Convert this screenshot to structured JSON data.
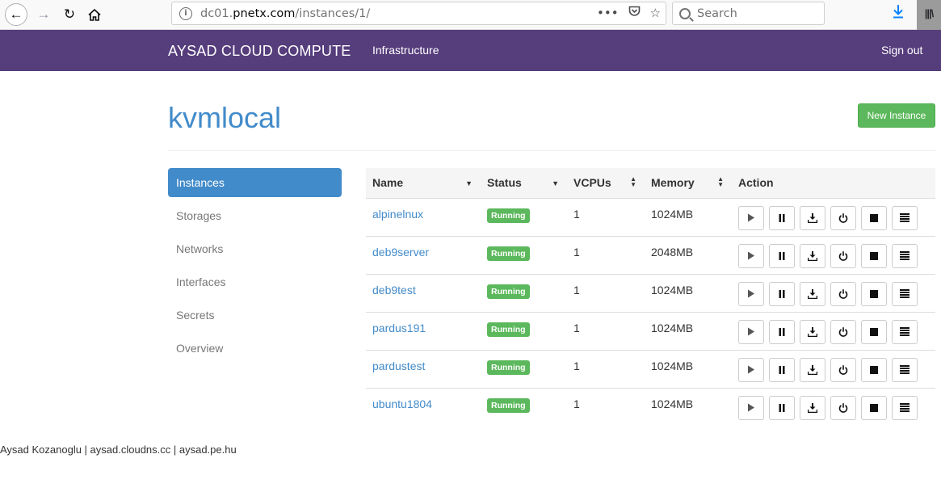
{
  "browser": {
    "url_prefix": "dc01.",
    "url_host": "pnetx.com",
    "url_path": "/instances/1/",
    "search_placeholder": "Search"
  },
  "navbar": {
    "brand": "AYSAD CLOUD COMPUTE",
    "infrastructure": "Infrastructure",
    "signout": "Sign out",
    "bg_color": "#563d7c"
  },
  "page": {
    "title": "kvmlocal",
    "new_instance_label": "New Instance"
  },
  "sidebar": {
    "items": [
      {
        "label": "Instances",
        "active": true
      },
      {
        "label": "Storages"
      },
      {
        "label": "Networks"
      },
      {
        "label": "Interfaces"
      },
      {
        "label": "Secrets"
      },
      {
        "label": "Overview"
      }
    ]
  },
  "table": {
    "headers": {
      "name": "Name",
      "status": "Status",
      "vcpus": "VCPUs",
      "memory": "Memory",
      "action": "Action"
    },
    "rows": [
      {
        "name": "alpinelnux",
        "status": "Running",
        "vcpus": "1",
        "memory": "1024MB"
      },
      {
        "name": "deb9server",
        "status": "Running",
        "vcpus": "1",
        "memory": "2048MB"
      },
      {
        "name": "deb9test",
        "status": "Running",
        "vcpus": "1",
        "memory": "1024MB"
      },
      {
        "name": "pardus191",
        "status": "Running",
        "vcpus": "1",
        "memory": "1024MB"
      },
      {
        "name": "pardustest",
        "status": "Running",
        "vcpus": "1",
        "memory": "1024MB"
      },
      {
        "name": "ubuntu1804",
        "status": "Running",
        "vcpus": "1",
        "memory": "1024MB"
      }
    ],
    "action_icons": [
      "play-icon",
      "pause-icon",
      "download-icon",
      "power-icon",
      "stop-icon",
      "menu-icon"
    ]
  },
  "footer": {
    "text": "Aysad Kozanoglu | aysad.cloudns.cc | aysad.pe.hu"
  }
}
